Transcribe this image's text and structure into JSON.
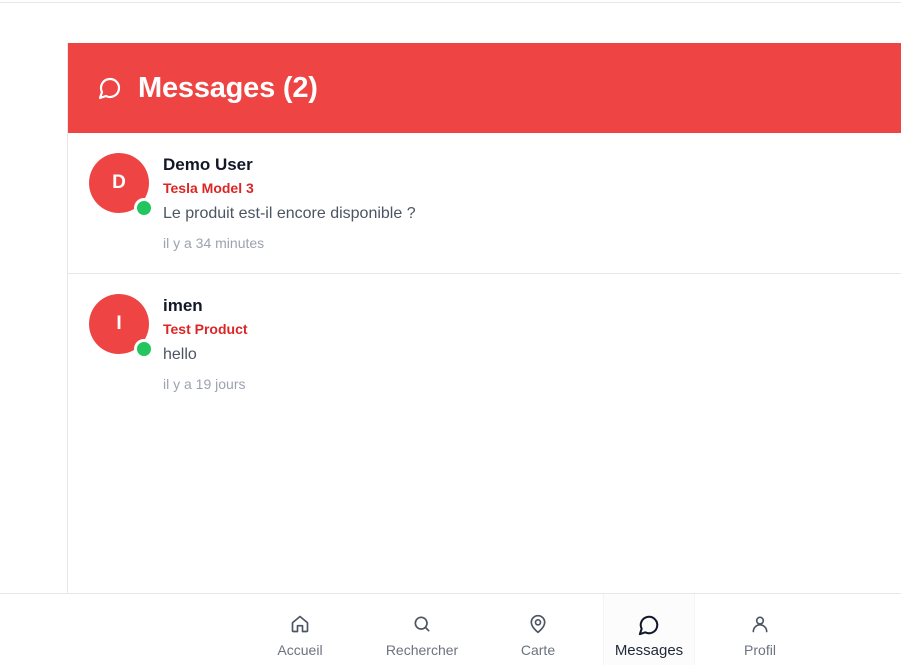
{
  "header": {
    "title": "Messages (2)",
    "icon": "message-circle-icon",
    "background": "#ef4444"
  },
  "conversations": [
    {
      "initial": "D",
      "name": "Demo User",
      "product": "Tesla Model 3",
      "last_message": "Le produit est-il encore disponible ?",
      "time": "il y a 34 minutes",
      "online": true
    },
    {
      "initial": "I",
      "name": "imen",
      "product": "Test Product",
      "last_message": "hello",
      "time": "il y a 19 jours",
      "online": true
    }
  ],
  "bottom_nav": {
    "items": [
      {
        "label": "Accueil",
        "icon": "home-icon"
      },
      {
        "label": "Rechercher",
        "icon": "search-icon"
      },
      {
        "label": "Carte",
        "icon": "map-pin-icon"
      },
      {
        "label": "Messages",
        "icon": "message-circle-icon",
        "active": true
      },
      {
        "label": "Profil",
        "icon": "user-icon"
      }
    ]
  },
  "colors": {
    "accent": "#ef4444",
    "product": "#dc2626",
    "online": "#22c55e"
  }
}
